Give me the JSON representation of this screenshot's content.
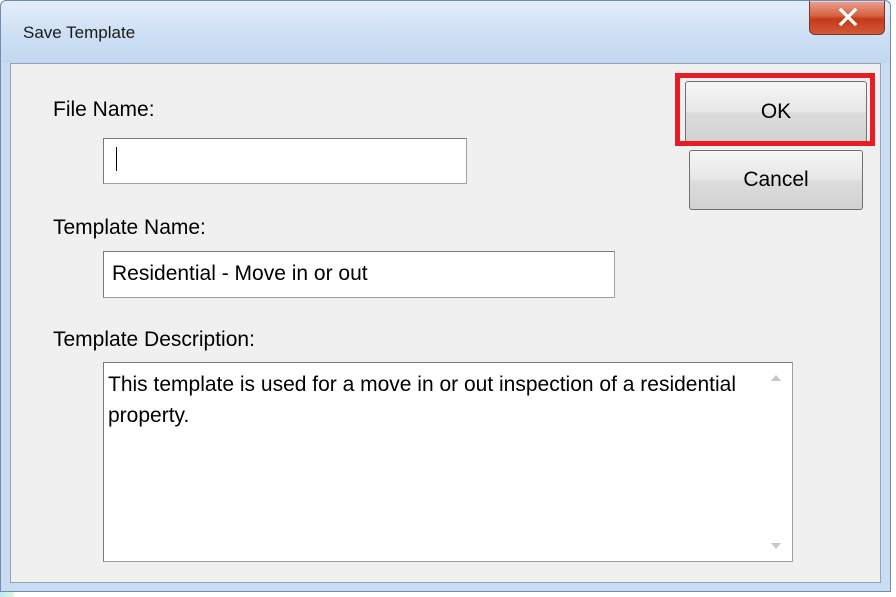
{
  "window": {
    "title": "Save Template",
    "close_icon": "close-x-icon"
  },
  "form": {
    "file_name_label": "File Name:",
    "file_name_value": "",
    "template_name_label": "Template Name:",
    "template_name_value": "Residential - Move in or out",
    "template_description_label": "Template Description:",
    "template_description_value": "This template is used for a move in or out inspection of a residential property."
  },
  "buttons": {
    "ok_label": "OK",
    "cancel_label": "Cancel"
  },
  "colors": {
    "highlight": "#e81c24",
    "close_button": "#c23a1a"
  }
}
